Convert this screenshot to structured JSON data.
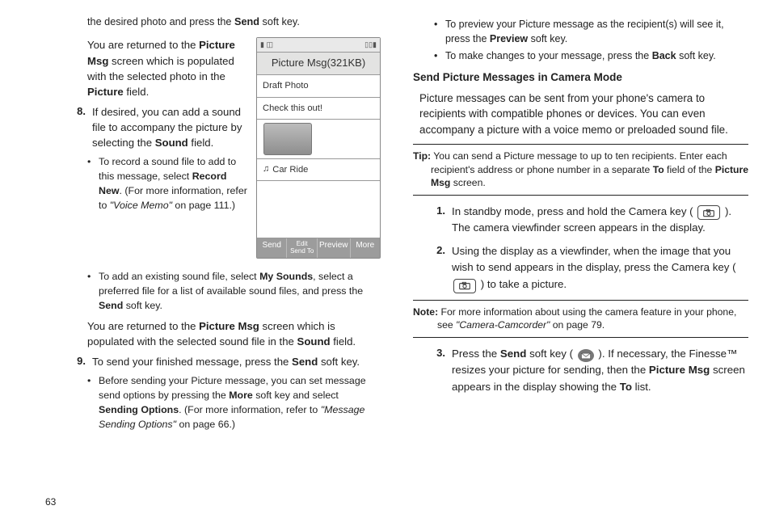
{
  "pageNumber": "63",
  "left": {
    "intro": {
      "pre": "the desired photo and press the ",
      "b": "Send",
      "post": " soft key."
    },
    "returned1": {
      "l1a": "You are returned to the ",
      "l2b": "Picture Msg",
      "l2a": " screen which is populated with the selected photo in the ",
      "l2c": "Picture",
      "l2d": " field."
    },
    "step8": {
      "num": "8.",
      "t1": "If desired, you can add a sound file to accompany the picture by selecting the ",
      "b": "Sound",
      "t2": " field."
    },
    "b8a": {
      "t1": "To record a sound file to add to this message, select ",
      "b": "Record New",
      "t2": ". (For more information, refer to ",
      "i": "\"Voice Memo\"",
      "t3": "  on page 111.)"
    },
    "b8b": {
      "t1": "To add an existing sound file, select ",
      "b1": "My Sounds",
      "t2": ", select a preferred file for a list of available sound files, and press the ",
      "b2": "Send",
      "t3": " soft key."
    },
    "returned2": {
      "t1": "You are returned to the ",
      "b1": "Picture Msg",
      "t2": " screen which is populated with the selected sound file in the ",
      "b2": "Sound",
      "t3": " field."
    },
    "step9": {
      "num": "9.",
      "t1": "To send your finished message, press the ",
      "b": "Send",
      "t2": " soft key."
    },
    "b9a": {
      "t1": "Before sending your Picture message, you can set message send options by pressing the ",
      "b1": "More",
      "t2": " soft key and select ",
      "b2": "Sending Options",
      "t3": ". (For more information, refer to ",
      "i": "\"Message Sending Options\"",
      "t4": "  on page 66.)"
    }
  },
  "figure": {
    "title": "Picture Msg(321KB)",
    "row1": "Draft Photo",
    "row2": "Check this out!",
    "row3": "Car Ride",
    "sk1": "Send",
    "sk2a": "Edit",
    "sk2b": "Send To",
    "sk3": "Preview",
    "sk4": "More"
  },
  "right": {
    "b1": {
      "t1": "To preview your Picture message as the recipient(s) will see it, press the ",
      "b": "Preview",
      "t2": " soft key."
    },
    "b2": {
      "t1": "To make changes to your message, press the ",
      "b": "Back",
      "t2": " soft key."
    },
    "heading": "Send Picture Messages in Camera Mode",
    "para": "Picture messages can be sent from your phone's camera to recipients with compatible phones or devices. You can even accompany a picture with a voice memo or preloaded sound file.",
    "tip": {
      "lead": "Tip:",
      "line1": " You can send a Picture message to up to ten recipients. Enter each",
      "line2": "recipient's address or phone number in a separate ",
      "b1": "To",
      "line2b": " field of the ",
      "b2": "Picture Msg",
      "line2c": " screen."
    },
    "s1": {
      "num": "1.",
      "t1": "In standby mode, press and hold the Camera key ( ",
      "t2": " ). The camera viewfinder screen appears in the display."
    },
    "s2": {
      "num": "2.",
      "t1": "Using the display as a viewfinder, when the image that you wish to send appears in the display, press the Camera key ( ",
      "t2": " ) to take a picture."
    },
    "note": {
      "lead": "Note:",
      "line1": " For more information about using the camera feature in your phone,",
      "line2": "see  ",
      "i": "\"Camera-Camcorder\"",
      "line2b": " on page 79."
    },
    "s3": {
      "num": "3.",
      "t1": "Press the ",
      "b1": "Send",
      "t2": " soft key ( ",
      "t3": " ). If necessary, the Finesse™ resizes your picture for sending, then the ",
      "b2": "Picture Msg",
      "t4": " screen appears in the display showing the ",
      "b3": "To",
      "t5": " list."
    }
  }
}
